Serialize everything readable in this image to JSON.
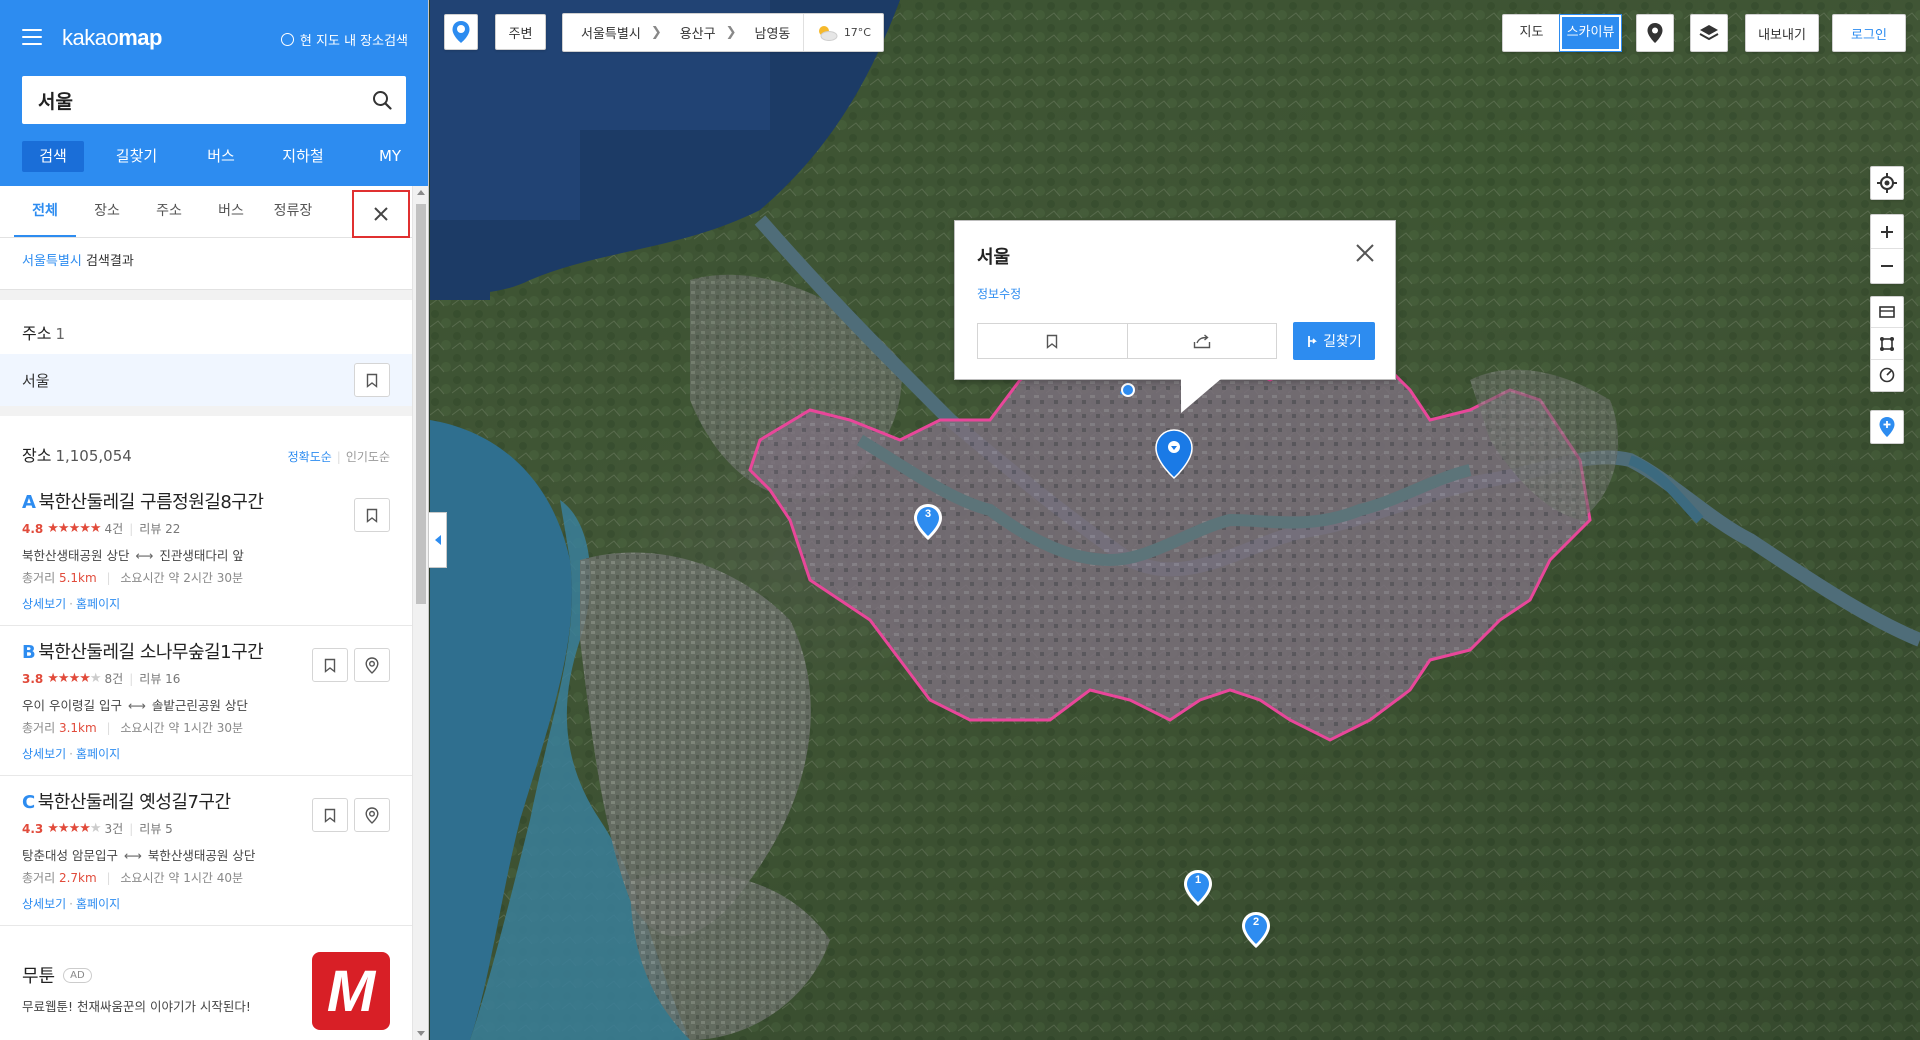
{
  "sidebar": {
    "logo": "kakaomap",
    "map_search_label": "현 지도 내 장소검색",
    "search_value": "서울",
    "nav_tabs": [
      "검색",
      "길찾기",
      "버스",
      "지하철",
      "MY"
    ],
    "result_tabs": [
      "전체",
      "장소",
      "주소",
      "버스",
      "정류장"
    ],
    "caption_link": "서울특별시",
    "caption_text": " 검색결과",
    "address_section": {
      "title": "주소",
      "count": "1",
      "item": "서울"
    },
    "place_section": {
      "title": "장소",
      "count": "1,105,054",
      "sort_accuracy": "정확도순",
      "sort_popular": "인기도순"
    },
    "places": [
      {
        "letter": "A",
        "name": "북한산둘레길 구름정원길8구간",
        "score": "4.8",
        "rating_count": "4건",
        "review": "리뷰 22",
        "from": "북한산생태공원 상단",
        "to": "진관생태다리 앞",
        "dist_label": "총거리",
        "dist": "5.1km",
        "time": "소요시간 약 2시간 30분",
        "detail": "상세보기",
        "home": "홈페이지",
        "stars_full": 5
      },
      {
        "letter": "B",
        "name": "북한산둘레길 소나무숲길1구간",
        "score": "3.8",
        "rating_count": "8건",
        "review": "리뷰 16",
        "from": "우이 우이령길 입구",
        "to": "솔밭근린공원 상단",
        "dist_label": "총거리",
        "dist": "3.1km",
        "time": "소요시간 약 1시간 30분",
        "detail": "상세보기",
        "home": "홈페이지",
        "stars_full": 4
      },
      {
        "letter": "C",
        "name": "북한산둘레길 옛성길7구간",
        "score": "4.3",
        "rating_count": "3건",
        "review": "리뷰 5",
        "from": "탕춘대성 암문입구",
        "to": "북한산생태공원 상단",
        "dist_label": "총거리",
        "dist": "2.7km",
        "time": "소요시간 약 1시간 40분",
        "detail": "상세보기",
        "home": "홈페이지",
        "stars_full": 4
      }
    ],
    "ad": {
      "name": "무툰",
      "badge": "AD",
      "desc": "무료웹툰! 천재싸움꾼의 이야기가 시작된다!",
      "logo_letter": "M"
    }
  },
  "map": {
    "around_label": "주변",
    "breadcrumb": [
      "서울특별시",
      "용산구",
      "남영동"
    ],
    "weather": "17°C",
    "map_types": [
      "지도",
      "스카이뷰"
    ],
    "export_label": "내보내기",
    "login_label": "로그인",
    "popup": {
      "title": "서울",
      "edit": "정보수정",
      "route": "길찾기"
    },
    "markers": [
      "1",
      "2",
      "3"
    ]
  },
  "colors": {
    "accent": "#2d8cf0",
    "highlight_border": "#e03030",
    "boundary": "#e8479a",
    "rating": "#e14b3b"
  }
}
